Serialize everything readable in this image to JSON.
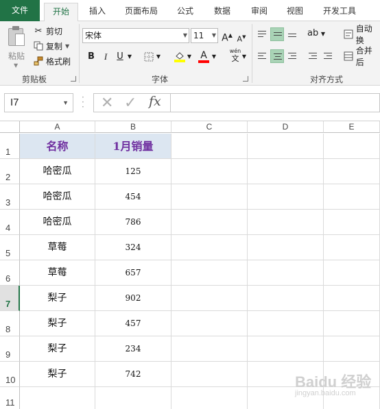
{
  "tabs": {
    "file": "文件",
    "home": "开始",
    "insert": "插入",
    "page_layout": "页面布局",
    "formulas": "公式",
    "data": "数据",
    "review": "审阅",
    "view": "视图",
    "developer": "开发工具"
  },
  "clipboard": {
    "paste": "粘贴",
    "cut": "剪切",
    "copy": "复制",
    "format_painter": "格式刷",
    "group_label": "剪贴板"
  },
  "font": {
    "name": "宋体",
    "size": "11",
    "bold": "B",
    "italic": "I",
    "underline": "U",
    "font_color_letter": "A",
    "phonetic_top": "wén",
    "phonetic_char": "文",
    "group_label": "字体",
    "grow": "A",
    "shrink": "A"
  },
  "alignment": {
    "wrap": "自动换",
    "merge": "合并后",
    "group_label": "对齐方式"
  },
  "formula_bar": {
    "name_box": "I7",
    "fx": "fx",
    "formula": ""
  },
  "columns": [
    "A",
    "B",
    "C",
    "D",
    "E"
  ],
  "rows": [
    "1",
    "2",
    "3",
    "4",
    "5",
    "6",
    "7",
    "8",
    "9",
    "10",
    "11"
  ],
  "selected_row": "7",
  "table": {
    "header": [
      "名称",
      "1月销量"
    ],
    "data": [
      [
        "哈密瓜",
        "125"
      ],
      [
        "哈密瓜",
        "454"
      ],
      [
        "哈密瓜",
        "786"
      ],
      [
        "草莓",
        "324"
      ],
      [
        "草莓",
        "657"
      ],
      [
        "梨子",
        "902"
      ],
      [
        "梨子",
        "457"
      ],
      [
        "梨子",
        "234"
      ],
      [
        "梨子",
        "742"
      ]
    ]
  },
  "watermark": {
    "brand": "Baidu 经验",
    "url": "jingyan.baidu.com"
  },
  "colors": {
    "excel_green": "#217346",
    "header_fill": "#dce6f1",
    "header_text": "#7030a0",
    "highlight_yellow": "#ffff00",
    "font_red": "#ff0000"
  }
}
